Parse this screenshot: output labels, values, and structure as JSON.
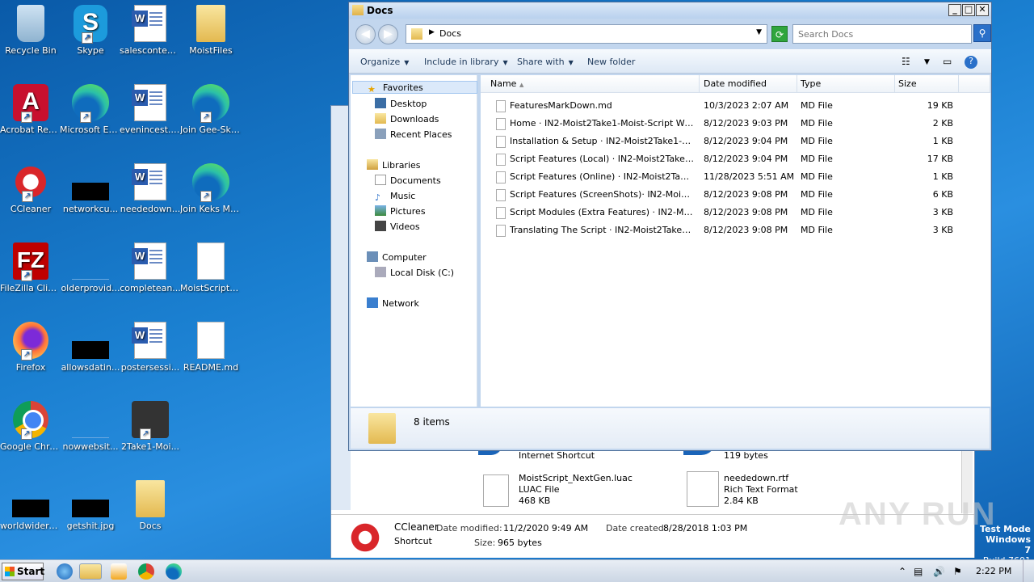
{
  "desktop": {
    "icons": [
      {
        "label": "Recycle Bin",
        "icon": "recycle-bin-icon"
      },
      {
        "label": "Skype",
        "icon": "skype-icon"
      },
      {
        "label": "salesconten...",
        "icon": "word-doc-icon"
      },
      {
        "label": "MoistFiles",
        "icon": "folder-icon"
      },
      {
        "label": "Acrobat Reader DC",
        "icon": "acrobat-icon"
      },
      {
        "label": "Microsoft Edge",
        "icon": "edge-icon"
      },
      {
        "label": "evenincest.rtf",
        "icon": "word-doc-icon"
      },
      {
        "label": "Join Gee-Skid Server for ...",
        "icon": "edge-icon"
      },
      {
        "label": "CCleaner",
        "icon": "ccleaner-icon"
      },
      {
        "label": "networkcu...",
        "icon": "black-thumbnail-icon"
      },
      {
        "label": "neededown...",
        "icon": "word-doc-icon"
      },
      {
        "label": "Join Keks Menu Disc...",
        "icon": "edge-icon"
      },
      {
        "label": "FileZilla Client",
        "icon": "filezilla-icon"
      },
      {
        "label": "olderprovid...",
        "icon": "blank-thumbnail-icon"
      },
      {
        "label": "completean...",
        "icon": "word-doc-icon"
      },
      {
        "label": "MoistScript_...",
        "icon": "blank-file-icon"
      },
      {
        "label": "Firefox",
        "icon": "firefox-icon"
      },
      {
        "label": "allowsdatin...",
        "icon": "black-thumbnail-icon"
      },
      {
        "label": "postersessi...",
        "icon": "word-doc-icon"
      },
      {
        "label": "README.md",
        "icon": "blank-file-icon"
      },
      {
        "label": "Google Chrome",
        "icon": "chrome-icon"
      },
      {
        "label": "nowwebsit...",
        "icon": "blank-thumbnail-icon"
      },
      {
        "label": "2Take1-Moi...",
        "icon": "game-icon"
      },
      {
        "label": "worldwidere...",
        "icon": "black-thumbnail-icon"
      },
      {
        "label": "getshit.jpg",
        "icon": "black-thumbnail-icon"
      },
      {
        "label": "Docs",
        "icon": "folder-icon"
      }
    ]
  },
  "back_window": {
    "files": [
      {
        "name": "Internet Shortcut",
        "type": "",
        "size": ""
      },
      {
        "name": "119 bytes",
        "type": "",
        "size": ""
      },
      {
        "name": "MoistScript_NextGen.luac",
        "type": "LUAC File",
        "size": "468 KB"
      },
      {
        "name": "neededown.rtf",
        "type": "Rich Text Format",
        "size": "2.84 KB"
      }
    ],
    "details": {
      "name": "CCleaner",
      "type": "Shortcut",
      "modified_label": "Date modified:",
      "modified": "11/2/2020 9:49 AM",
      "created_label": "Date created:",
      "created": "8/28/2018 1:03 PM",
      "size_label": "Size:",
      "size": "965 bytes"
    }
  },
  "explorer": {
    "title": "Docs",
    "address": "Docs",
    "search_placeholder": "Search Docs",
    "toolbar": {
      "organize": "Organize",
      "include": "Include in library",
      "share": "Share with",
      "new_folder": "New folder"
    },
    "nav": {
      "favorites": "Favorites",
      "desktop": "Desktop",
      "downloads": "Downloads",
      "recent": "Recent Places",
      "libraries": "Libraries",
      "documents": "Documents",
      "music": "Music",
      "pictures": "Pictures",
      "videos": "Videos",
      "computer": "Computer",
      "local_disk": "Local Disk (C:)",
      "network": "Network"
    },
    "columns": {
      "name": "Name",
      "date": "Date modified",
      "type": "Type",
      "size": "Size"
    },
    "files": [
      {
        "name": "FeaturesMarkDown.md",
        "date": "10/3/2023 2:07 AM",
        "type": "MD File",
        "size": "19 KB"
      },
      {
        "name": "Home · IN2-Moist2Take1-Moist-Script Wiki.md",
        "date": "8/12/2023 9:03 PM",
        "type": "MD File",
        "size": "2 KB"
      },
      {
        "name": "Installation & Setup · IN2-Moist2Take1-Moist...",
        "date": "8/12/2023 9:04 PM",
        "type": "MD File",
        "size": "1 KB"
      },
      {
        "name": "Script Features (Local) · IN2-Moist2Take1-M...",
        "date": "8/12/2023 9:04 PM",
        "type": "MD File",
        "size": "17 KB"
      },
      {
        "name": "Script Features (Online) · IN2-Moist2Take1-...",
        "date": "11/28/2023 5:51 AM",
        "type": "MD File",
        "size": "1 KB"
      },
      {
        "name": "Script Features (ScreenShots)· IN2-Moist2Ta...",
        "date": "8/12/2023 9:08 PM",
        "type": "MD File",
        "size": "6 KB"
      },
      {
        "name": "Script Modules (Extra Features) · IN2-Moist2...",
        "date": "8/12/2023 9:08 PM",
        "type": "MD File",
        "size": "3 KB"
      },
      {
        "name": "Translating The Script · IN2-Moist2Take1-Moi...",
        "date": "8/12/2023 9:08 PM",
        "type": "MD File",
        "size": "3 KB"
      }
    ],
    "status": "8 items"
  },
  "taskbar": {
    "start": "Start",
    "clock": "2:22 PM"
  },
  "watermark": {
    "line1": "Test Mode",
    "line2": "Windows 7",
    "line3": "Build 7601",
    "brand": "ANY RUN"
  }
}
